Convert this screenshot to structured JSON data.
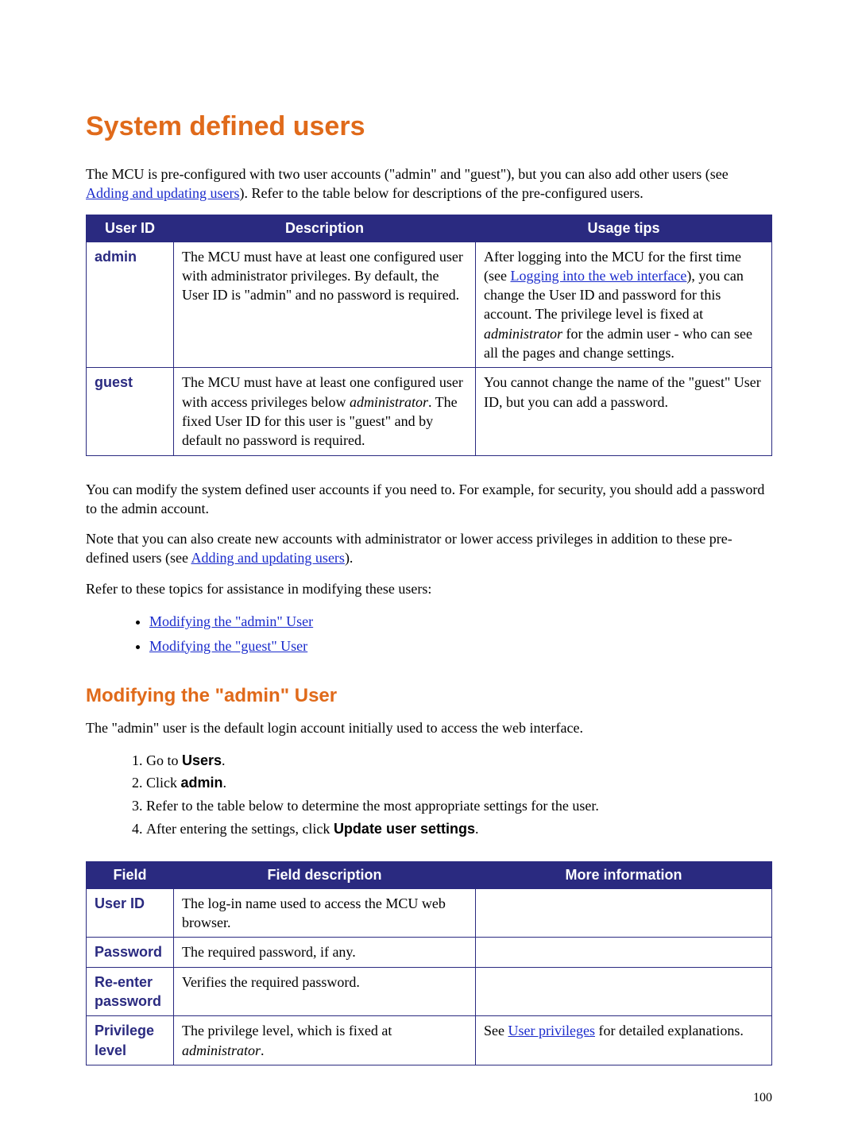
{
  "page_number": "100",
  "title": "System defined users",
  "intro": {
    "pre": "The MCU is pre-configured with two user accounts (\"admin\" and \"guest\"), but you can also add other users (see ",
    "link": "Adding and updating users",
    "post": "). Refer to the table below for descriptions of the pre-configured users."
  },
  "table1": {
    "headers": {
      "c1": "User ID",
      "c2": "Description",
      "c3": "Usage tips"
    },
    "rows": [
      {
        "id": "admin",
        "desc": "The MCU must have at least one configured user with administrator privileges. By default, the User ID is \"admin\" and no password is required.",
        "tips_pre": "After logging into the MCU for the first time (see ",
        "tips_link": "Logging into the web interface",
        "tips_post1": "), you can change the User ID and password for this account. The privilege level is fixed at ",
        "tips_italic": "administrator",
        "tips_post2": " for the admin user - who can see all the pages and change settings."
      },
      {
        "id": "guest",
        "desc_pre": "The MCU must have at least one configured user with access privileges below ",
        "desc_italic": "administrator",
        "desc_post": ". The fixed User ID for this user is \"guest\" and by default no password is required.",
        "tips": "You cannot change the name of the \"guest\" User ID, but you can add a password."
      }
    ]
  },
  "para2": "You can modify the system defined user accounts if you need to. For example, for security, you should add a password to the admin account.",
  "para3": {
    "pre": "Note that you can also create new accounts with administrator or lower access privileges in addition to these pre-defined users (see ",
    "link": "Adding and updating users",
    "post": ")."
  },
  "para4": "Refer to these topics for assistance in modifying these users:",
  "links_list": [
    "Modifying the \"admin\" User",
    "Modifying the \"guest\" User"
  ],
  "subhead": "Modifying the \"admin\" User",
  "para5": "The \"admin\" user is the default login account initially used to access the web interface.",
  "steps": {
    "s1_pre": "Go to ",
    "s1_bold": "Users",
    "s1_post": ".",
    "s2_pre": "Click ",
    "s2_bold": "admin",
    "s2_post": ".",
    "s3": "Refer to the table below to determine the most appropriate settings for the user.",
    "s4_pre": "After entering the settings, click ",
    "s4_bold": "Update user settings",
    "s4_post": "."
  },
  "table2": {
    "headers": {
      "c1": "Field",
      "c2": "Field description",
      "c3": "More information"
    },
    "rows": {
      "r1": {
        "f": "User ID",
        "d": "The log-in name used to access the MCU web browser.",
        "m": ""
      },
      "r2": {
        "f": "Password",
        "d": "The required password, if any.",
        "m": ""
      },
      "r3": {
        "f": "Re-enter password",
        "d": "Verifies the required password.",
        "m": ""
      },
      "r4": {
        "f": "Privilege level",
        "d_pre": "The privilege level, which is fixed at ",
        "d_italic": "administrator",
        "d_post": ".",
        "m_pre": "See ",
        "m_link": "User privileges",
        "m_post": " for detailed explanations."
      }
    }
  }
}
